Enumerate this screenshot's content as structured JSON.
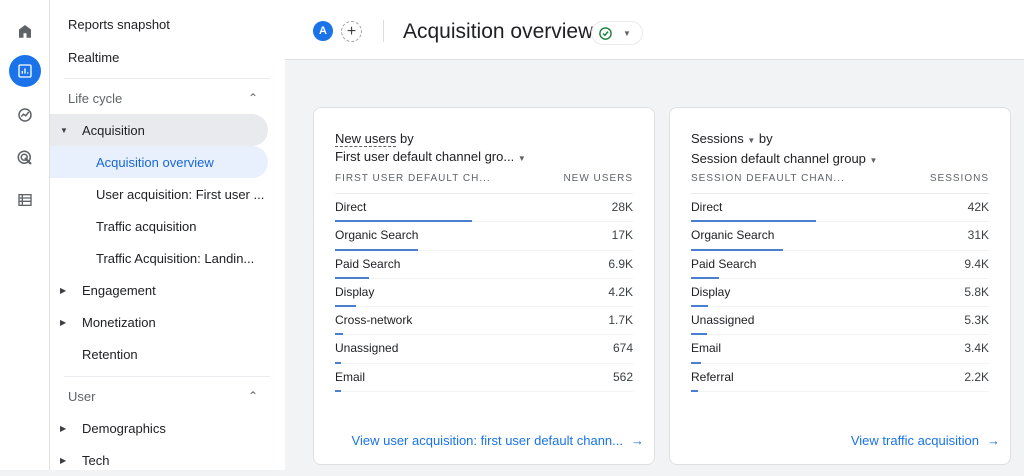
{
  "rail": {
    "icons": [
      "home-icon",
      "reports-icon",
      "explore-icon",
      "advertising-icon",
      "configure-icon"
    ],
    "active": 1
  },
  "sidebar": {
    "reports_snapshot": "Reports snapshot",
    "realtime": "Realtime",
    "lifecycle": "Life cycle",
    "acquisition": "Acquisition",
    "acq_items": [
      "Acquisition overview",
      "User acquisition: First user ...",
      "Traffic acquisition",
      "Traffic Acquisition: Landin..."
    ],
    "engagement": "Engagement",
    "monetization": "Monetization",
    "retention": "Retention",
    "user": "User",
    "demographics": "Demographics",
    "tech": "Tech"
  },
  "header": {
    "avatar": "A",
    "plus": "+",
    "title": "Acquisition overview",
    "status_icon": "check-circle-icon",
    "colors": {
      "accent": "#1a73e8",
      "status": "#188038"
    }
  },
  "cards": [
    {
      "metric": "New users",
      "by": " by",
      "dimension": "First user default channel gro...",
      "col1": "FIRST USER DEFAULT CH...",
      "col2": "NEW USERS",
      "rows": [
        {
          "label": "Direct",
          "value": "28K",
          "n": 28000
        },
        {
          "label": "Organic Search",
          "value": "17K",
          "n": 17000
        },
        {
          "label": "Paid Search",
          "value": "6.9K",
          "n": 6900
        },
        {
          "label": "Display",
          "value": "4.2K",
          "n": 4200
        },
        {
          "label": "Cross-network",
          "value": "1.7K",
          "n": 1700
        },
        {
          "label": "Unassigned",
          "value": "674",
          "n": 674
        },
        {
          "label": "Email",
          "value": "562",
          "n": 562
        }
      ],
      "link": "View user acquisition: first user default chann..."
    },
    {
      "metric": "Sessions",
      "by": " by",
      "dimension": "Session default channel group",
      "col1": "SESSION DEFAULT CHAN...",
      "col2": "SESSIONS",
      "rows": [
        {
          "label": "Direct",
          "value": "42K",
          "n": 42000
        },
        {
          "label": "Organic Search",
          "value": "31K",
          "n": 31000
        },
        {
          "label": "Paid Search",
          "value": "9.4K",
          "n": 9400
        },
        {
          "label": "Display",
          "value": "5.8K",
          "n": 5800
        },
        {
          "label": "Unassigned",
          "value": "5.3K",
          "n": 5300
        },
        {
          "label": "Email",
          "value": "3.4K",
          "n": 3400
        },
        {
          "label": "Referral",
          "value": "2.2K",
          "n": 2200
        }
      ],
      "link": "View traffic acquisition"
    }
  ]
}
